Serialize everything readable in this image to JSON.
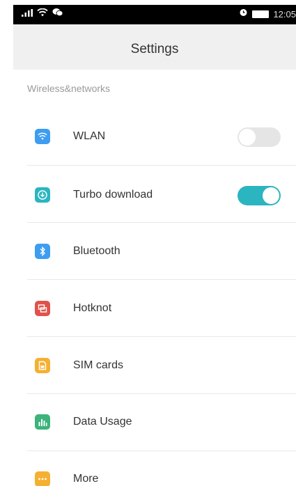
{
  "status_bar": {
    "time": "12:05",
    "left_icons": [
      "signal-icon",
      "wifi-icon",
      "wechat-icon"
    ],
    "right_icons": [
      "alarm-icon",
      "battery-icon"
    ]
  },
  "header": {
    "title": "Settings"
  },
  "section": {
    "title": "Wireless&networks"
  },
  "items": [
    {
      "label": "WLAN",
      "icon": "wifi-icon",
      "icon_color": "#3d9df0",
      "toggle": false
    },
    {
      "label": "Turbo download",
      "icon": "download-icon",
      "icon_color": "#2bb5c0",
      "toggle": true
    },
    {
      "label": "Bluetooth",
      "icon": "bluetooth-icon",
      "icon_color": "#3d9df0"
    },
    {
      "label": "Hotknot",
      "icon": "hotknot-icon",
      "icon_color": "#e0524a"
    },
    {
      "label": "SIM cards",
      "icon": "sim-card-icon",
      "icon_color": "#f5b031"
    },
    {
      "label": "Data Usage",
      "icon": "data-usage-icon",
      "icon_color": "#3bb37a"
    },
    {
      "label": "More",
      "icon": "more-icon",
      "icon_color": "#f5b031"
    }
  ],
  "colors": {
    "toggle_on": "#2bb5c0",
    "toggle_off": "#e5e5e5",
    "title_bar_bg": "#f0f0f0"
  }
}
